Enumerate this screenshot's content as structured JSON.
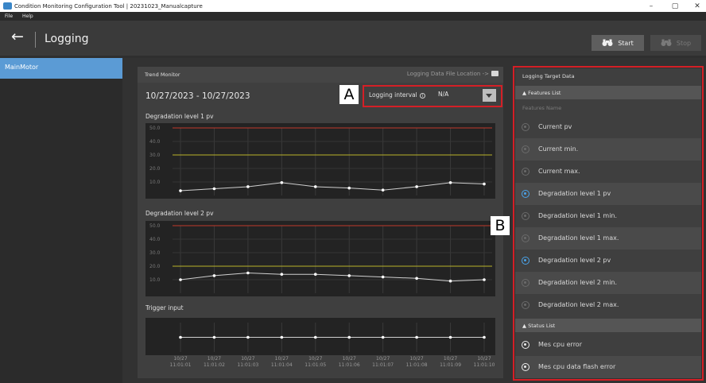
{
  "window": {
    "title": "Condition Monitoring Configuration Tool  |  20231023_Manualcapture",
    "minimize": "–",
    "maximize": "▢",
    "close": "✕"
  },
  "menu": {
    "items": [
      "File",
      "Help"
    ]
  },
  "header": {
    "back_icon": "←",
    "title": "Logging",
    "start_label": "Start",
    "stop_label": "Stop",
    "start_icon": "binoculars-icon",
    "stop_icon": "binoculars-icon"
  },
  "sidebar": {
    "items": [
      {
        "label": "MainMotor",
        "selected": true
      }
    ]
  },
  "trend": {
    "title": "Trend Monitor",
    "log_location_label": "Logging Data File Location  ->",
    "date_range": "10/27/2023 - 10/27/2023",
    "interval_label": "Logging interval",
    "interval_value": "N/A",
    "callout_a": "A",
    "chart1_label": "Degradation level 1 pv",
    "chart2_label": "Degradation level 2 pv",
    "chart3_label": "Trigger input",
    "yticks": [
      "50.0",
      "40.0",
      "30.0",
      "20.0",
      "10.0"
    ],
    "xticks_date": [
      "10/27",
      "10/27",
      "10/27",
      "10/27",
      "10/27",
      "10/27",
      "10/27",
      "10/27",
      "10/27",
      "10/27"
    ],
    "xticks_time": [
      "11:01:01",
      "11:01:02",
      "11:01:03",
      "11:01:04",
      "11:01:05",
      "11:01:06",
      "11:01:07",
      "11:01:08",
      "11:01:09",
      "11:01:10"
    ]
  },
  "chart_data": [
    {
      "type": "line",
      "title": "Degradation level 1 pv",
      "x": [
        "11:01:01",
        "11:01:02",
        "11:01:03",
        "11:01:04",
        "11:01:05",
        "11:01:06",
        "11:01:07",
        "11:01:08",
        "11:01:09",
        "11:01:10"
      ],
      "series": [
        {
          "values": [
            3.5,
            5.0,
            6.5,
            9.5,
            6.5,
            5.5,
            4.0,
            6.5,
            9.5,
            8.5
          ]
        }
      ],
      "thresholds": [
        {
          "value": 50,
          "color": "#c0392b"
        },
        {
          "value": 30,
          "color": "#b8b32a"
        }
      ],
      "ylim": [
        0,
        50
      ]
    },
    {
      "type": "line",
      "title": "Degradation level 2 pv",
      "x": [
        "11:01:01",
        "11:01:02",
        "11:01:03",
        "11:01:04",
        "11:01:05",
        "11:01:06",
        "11:01:07",
        "11:01:08",
        "11:01:09",
        "11:01:10"
      ],
      "series": [
        {
          "values": [
            10.0,
            13.0,
            15.0,
            14.0,
            14.0,
            13.0,
            12.0,
            11.0,
            9.0,
            10.0
          ]
        }
      ],
      "thresholds": [
        {
          "value": 50,
          "color": "#c0392b"
        },
        {
          "value": 20,
          "color": "#b8b32a"
        }
      ],
      "ylim": [
        0,
        50
      ]
    },
    {
      "type": "line",
      "title": "Trigger input",
      "x": [
        "11:01:01",
        "11:01:02",
        "11:01:03",
        "11:01:04",
        "11:01:05",
        "11:01:06",
        "11:01:07",
        "11:01:08",
        "11:01:09",
        "11:01:10"
      ],
      "series": [
        {
          "values": [
            1,
            1,
            1,
            1,
            1,
            1,
            1,
            1,
            1,
            1
          ]
        }
      ],
      "ylim": [
        0,
        2
      ]
    }
  ],
  "target": {
    "title": "Logging Target Data",
    "features_header": "▲  Features List",
    "col_header": "Features Name",
    "callout_b": "B",
    "features": [
      {
        "label": "Current pv",
        "active": false
      },
      {
        "label": "Current min.",
        "active": false
      },
      {
        "label": "Current max.",
        "active": false
      },
      {
        "label": "Degradation level 1 pv",
        "active": true
      },
      {
        "label": "Degradation level 1 min.",
        "active": false
      },
      {
        "label": "Degradation level 1 max.",
        "active": false
      },
      {
        "label": "Degradation level 2 pv",
        "active": true
      },
      {
        "label": "Degradation level 2 min.",
        "active": false
      },
      {
        "label": "Degradation level 2 max.",
        "active": false
      }
    ],
    "status_header": "▲  Status List",
    "status": [
      {
        "label": "Mes cpu error"
      },
      {
        "label": "Mes cpu data flash error"
      }
    ]
  },
  "colors": {
    "accent": "#5b9bd5",
    "callout_border": "#d41f26",
    "active_eye": "#4aa3e8",
    "series_line": "#cfcfcf"
  }
}
